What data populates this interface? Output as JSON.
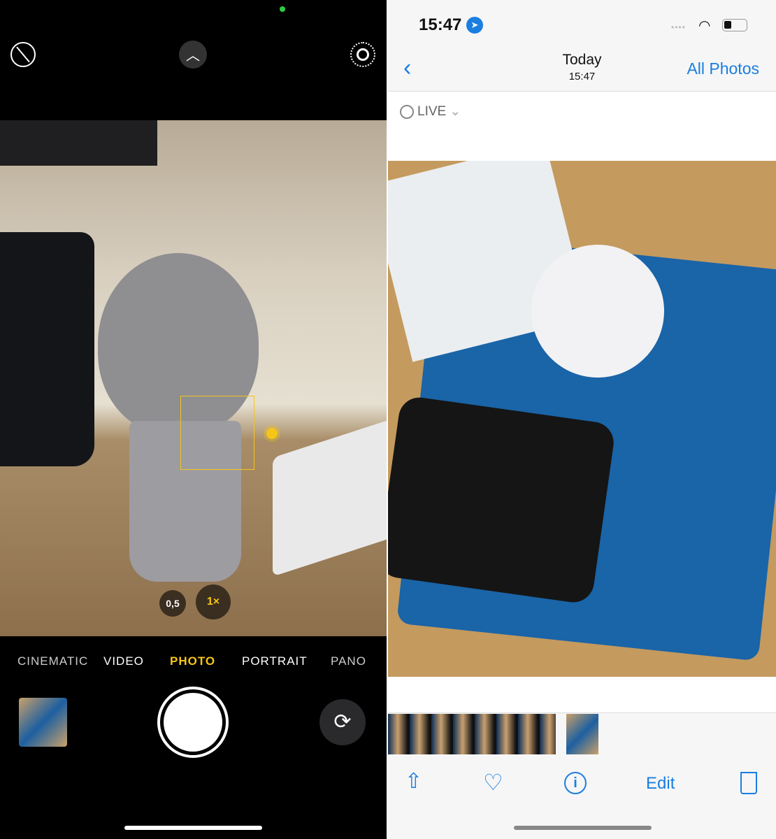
{
  "camera": {
    "zoom_options": [
      "0,5",
      "1×"
    ],
    "modes": [
      "CINEMATIC",
      "VIDEO",
      "PHOTO",
      "PORTRAIT",
      "PANO"
    ],
    "selected_mode": "PHOTO",
    "accent": "#f5c518",
    "icons": [
      "flash-off-icon",
      "chevron-up-icon",
      "live-photo-icon",
      "flip-camera-icon",
      "sun-icon"
    ]
  },
  "photos": {
    "status": {
      "time": "15:47"
    },
    "nav": {
      "title": "Today",
      "subtitle": "15:47",
      "all_photos": "All Photos"
    },
    "live_label": "LIVE",
    "toolbar": {
      "edit": "Edit"
    },
    "accent": "#1a7ee0"
  }
}
